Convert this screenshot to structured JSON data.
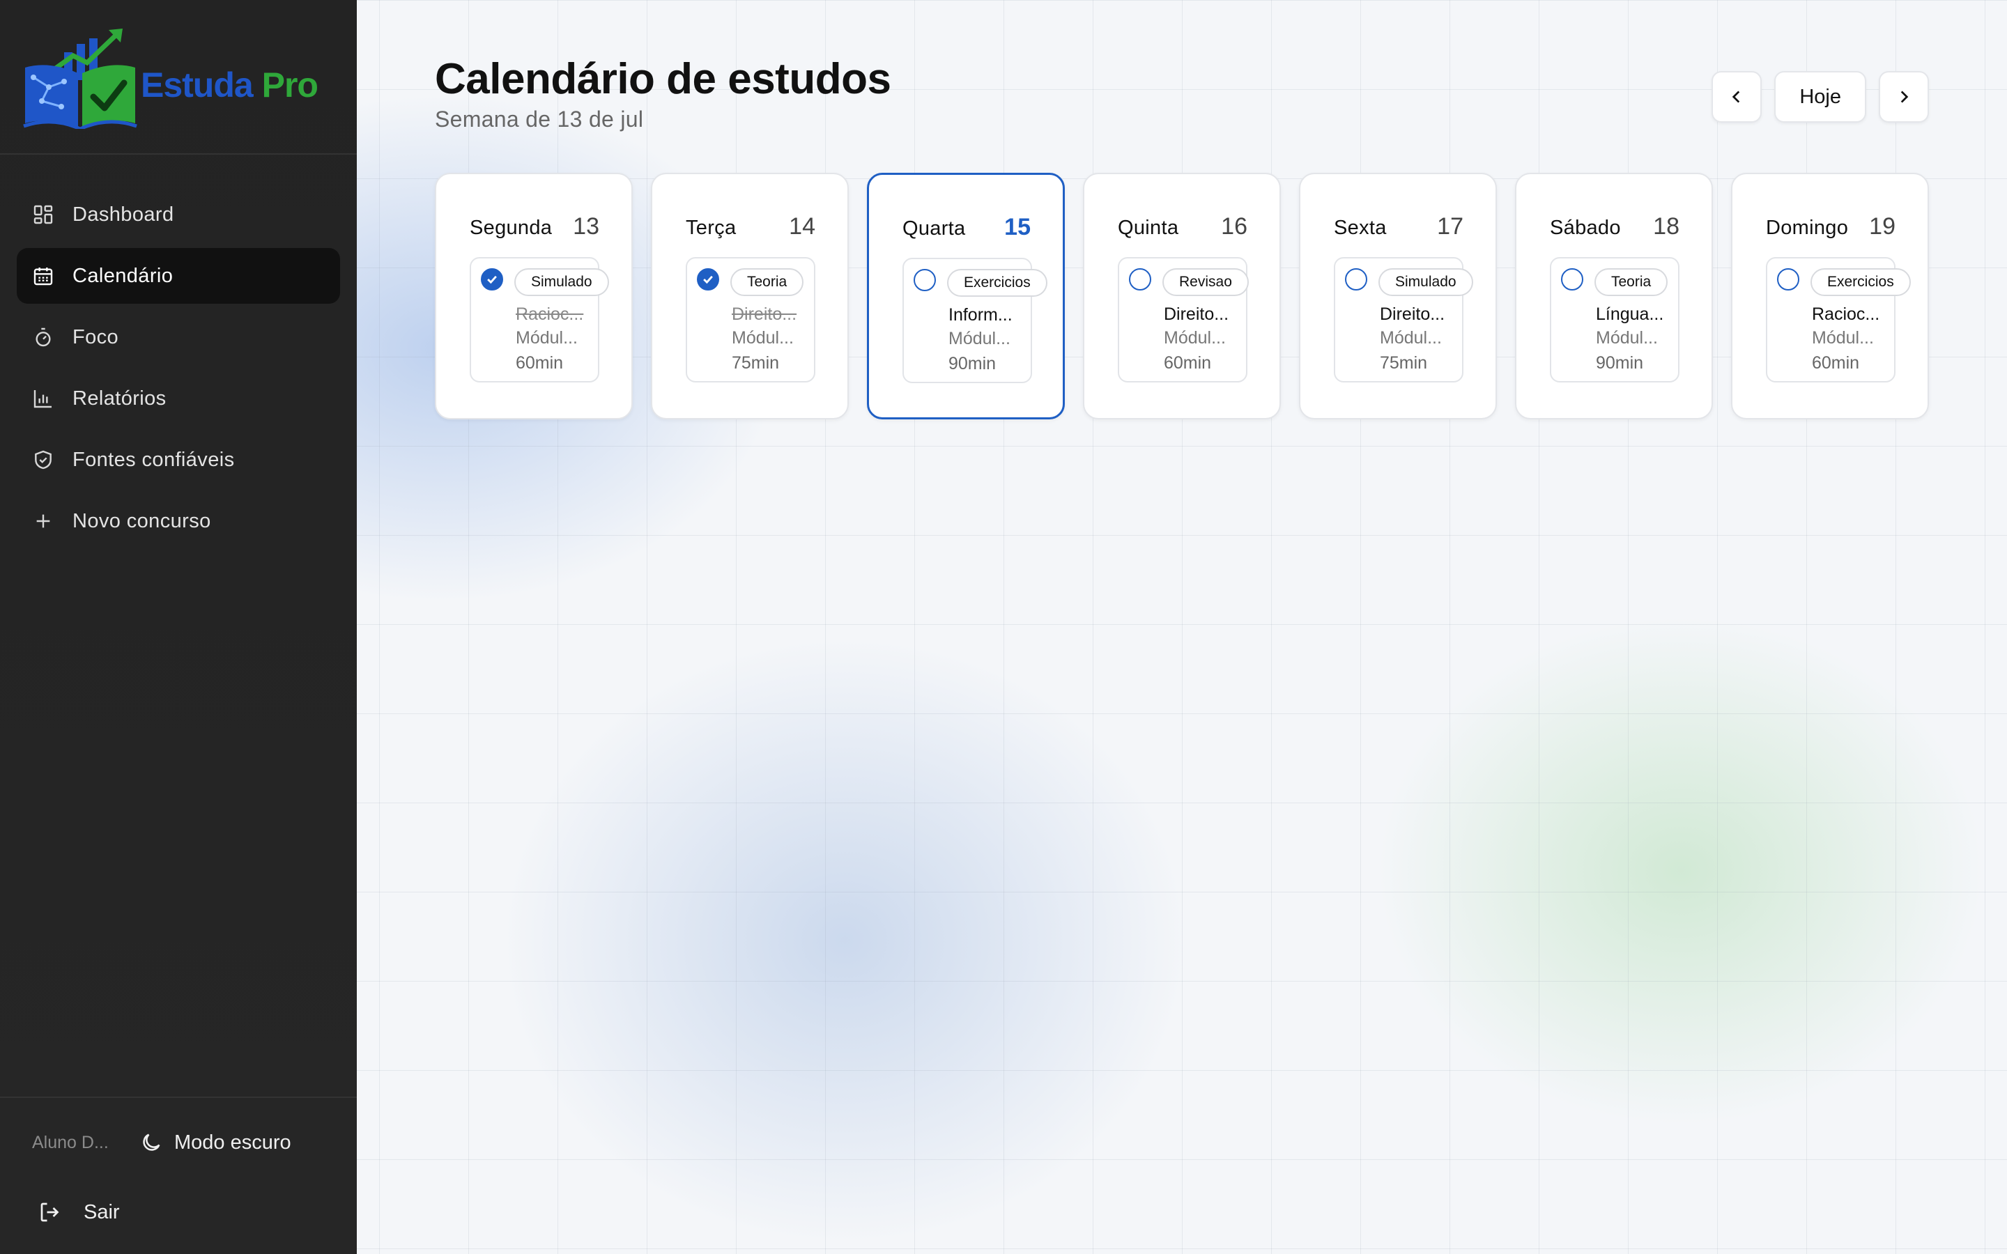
{
  "brand": {
    "part1": "Estuda",
    "part2": " Pro"
  },
  "nav": [
    {
      "label": "Dashboard",
      "icon": "dashboard-icon",
      "active": false
    },
    {
      "label": "Calendário",
      "icon": "calendar-icon",
      "active": true
    },
    {
      "label": "Foco",
      "icon": "timer-icon",
      "active": false
    },
    {
      "label": "Relatórios",
      "icon": "bar-chart-icon",
      "active": false
    },
    {
      "label": "Fontes confiáveis",
      "icon": "shield-check-icon",
      "active": false
    },
    {
      "label": "Novo concurso",
      "icon": "plus-icon",
      "active": false
    }
  ],
  "footer": {
    "user": "Aluno D...",
    "dark_mode": "Modo escuro",
    "logout": "Sair"
  },
  "header": {
    "title": "Calendário de estudos",
    "subtitle": "Semana de 13 de jul"
  },
  "controls": {
    "today": "Hoje"
  },
  "colors": {
    "accent": "#1f5fc4",
    "brand_blue": "#1f56c8",
    "brand_green": "#2fa83a"
  },
  "days": [
    {
      "name": "Segunda",
      "num": "13",
      "today": false,
      "task": {
        "done": true,
        "tag": "Simulado",
        "title": "Racioc...",
        "module": "Módul...",
        "duration": "60min"
      }
    },
    {
      "name": "Terça",
      "num": "14",
      "today": false,
      "task": {
        "done": true,
        "tag": "Teoria",
        "title": "Direito...",
        "module": "Módul...",
        "duration": "75min"
      }
    },
    {
      "name": "Quarta",
      "num": "15",
      "today": true,
      "task": {
        "done": false,
        "tag": "Exercicios",
        "title": "Inform...",
        "module": "Módul...",
        "duration": "90min"
      }
    },
    {
      "name": "Quinta",
      "num": "16",
      "today": false,
      "task": {
        "done": false,
        "tag": "Revisao",
        "title": "Direito...",
        "module": "Módul...",
        "duration": "60min"
      }
    },
    {
      "name": "Sexta",
      "num": "17",
      "today": false,
      "task": {
        "done": false,
        "tag": "Simulado",
        "title": "Direito...",
        "module": "Módul...",
        "duration": "75min"
      }
    },
    {
      "name": "Sábado",
      "num": "18",
      "today": false,
      "task": {
        "done": false,
        "tag": "Teoria",
        "title": "Língua...",
        "module": "Módul...",
        "duration": "90min"
      }
    },
    {
      "name": "Domingo",
      "num": "19",
      "today": false,
      "task": {
        "done": false,
        "tag": "Exercicios",
        "title": "Racioc...",
        "module": "Módul...",
        "duration": "60min"
      }
    }
  ]
}
